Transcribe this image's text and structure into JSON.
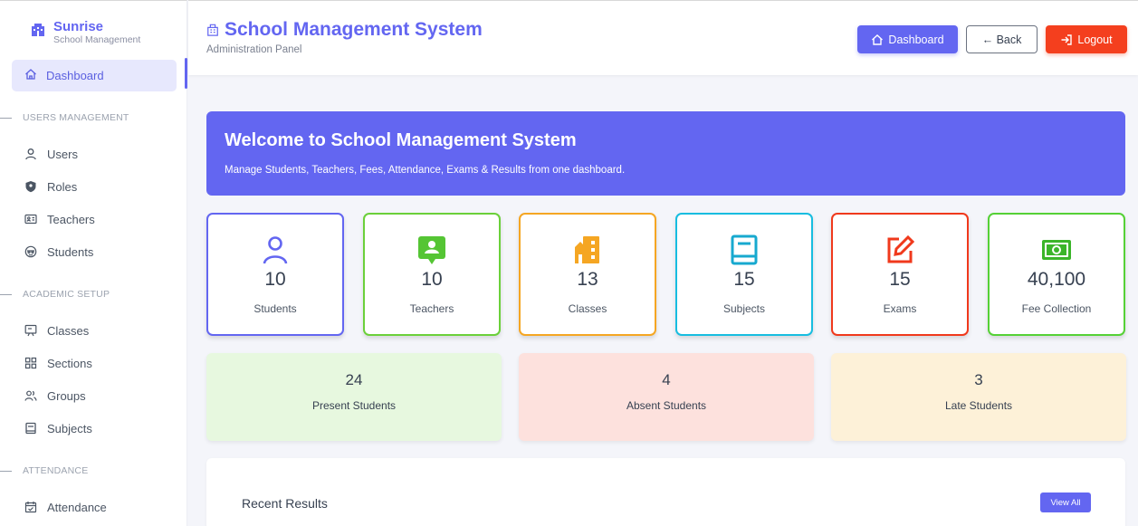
{
  "brand": {
    "name": "Sunrise",
    "sub": "School Management"
  },
  "sidebar": {
    "active": {
      "label": "Dashboard",
      "icon": "home-icon"
    },
    "sections": [
      {
        "title": "USERS MANAGEMENT",
        "items": [
          {
            "label": "Users",
            "icon": "user-icon"
          },
          {
            "label": "Roles",
            "icon": "shield-icon"
          },
          {
            "label": "Teachers",
            "icon": "id-card-icon"
          },
          {
            "label": "Students",
            "icon": "student-icon"
          }
        ]
      },
      {
        "title": "ACADEMIC SETUP",
        "items": [
          {
            "label": "Classes",
            "icon": "presentation-icon"
          },
          {
            "label": "Sections",
            "icon": "grid-icon"
          },
          {
            "label": "Groups",
            "icon": "users-icon"
          },
          {
            "label": "Subjects",
            "icon": "book-icon"
          }
        ]
      },
      {
        "title": "ATTENDANCE",
        "items": [
          {
            "label": "Attendance",
            "icon": "calendar-check-icon"
          }
        ]
      }
    ]
  },
  "header": {
    "title": "School Management System",
    "subtitle": "Administration Panel",
    "buttons": {
      "dashboard": "Dashboard",
      "back": "← Back",
      "logout": "Logout"
    }
  },
  "welcome": {
    "title": "Welcome to School Management System",
    "text": "Manage Students, Teachers, Fees, Attendance, Exams & Results from one dashboard."
  },
  "stats": [
    {
      "value": "10",
      "label": "Students",
      "color": "#6366f1",
      "icon": "user-icon"
    },
    {
      "value": "10",
      "label": "Teachers",
      "color": "#6bd03a",
      "icon": "teacher-board-icon"
    },
    {
      "value": "13",
      "label": "Classes",
      "color": "#f5a623",
      "icon": "building-icon"
    },
    {
      "value": "15",
      "label": "Subjects",
      "color": "#17bde0",
      "icon": "book-icon"
    },
    {
      "value": "15",
      "label": "Exams",
      "color": "#f0391c",
      "icon": "edit-icon"
    },
    {
      "value": "40,100",
      "label": "Fee Collection",
      "color": "#55d136",
      "icon": "money-icon"
    }
  ],
  "attendance": [
    {
      "value": "24",
      "label": "Present Students",
      "bg": "#e7f8df"
    },
    {
      "value": "4",
      "label": "Absent Students",
      "bg": "#fde1dd"
    },
    {
      "value": "3",
      "label": "Late Students",
      "bg": "#fdf1d8"
    }
  ],
  "results": {
    "title": "Recent Results",
    "view_all": "View All"
  }
}
